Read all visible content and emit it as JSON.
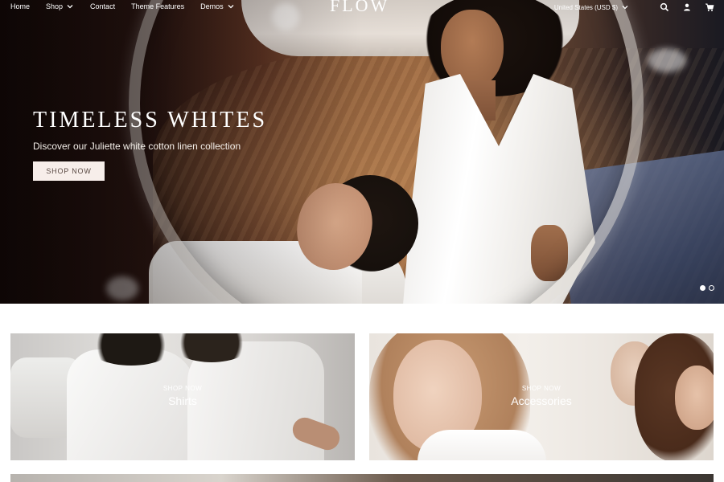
{
  "header": {
    "nav": [
      {
        "label": "Home",
        "has_dropdown": false
      },
      {
        "label": "Shop",
        "has_dropdown": true
      },
      {
        "label": "Contact",
        "has_dropdown": false
      },
      {
        "label": "Theme Features",
        "has_dropdown": false
      },
      {
        "label": "Demos",
        "has_dropdown": true
      }
    ],
    "logo": "FLOW",
    "currency": "United States (USD $)",
    "icons": [
      "search-icon",
      "account-icon",
      "cart-icon"
    ]
  },
  "hero": {
    "title": "TIMELESS WHITES",
    "subtitle": "Discover our Juliette white cotton linen collection",
    "button": "SHOP NOW",
    "slides_total": 2,
    "active_slide": 1
  },
  "tiles": [
    {
      "kicker": "SHOP NOW",
      "title": "Shirts"
    },
    {
      "kicker": "SHOP NOW",
      "title": "Accessories"
    }
  ],
  "colors": {
    "button_bg": "#f7eeea",
    "button_text": "#5a4a44",
    "text_light": "#ffffff"
  }
}
